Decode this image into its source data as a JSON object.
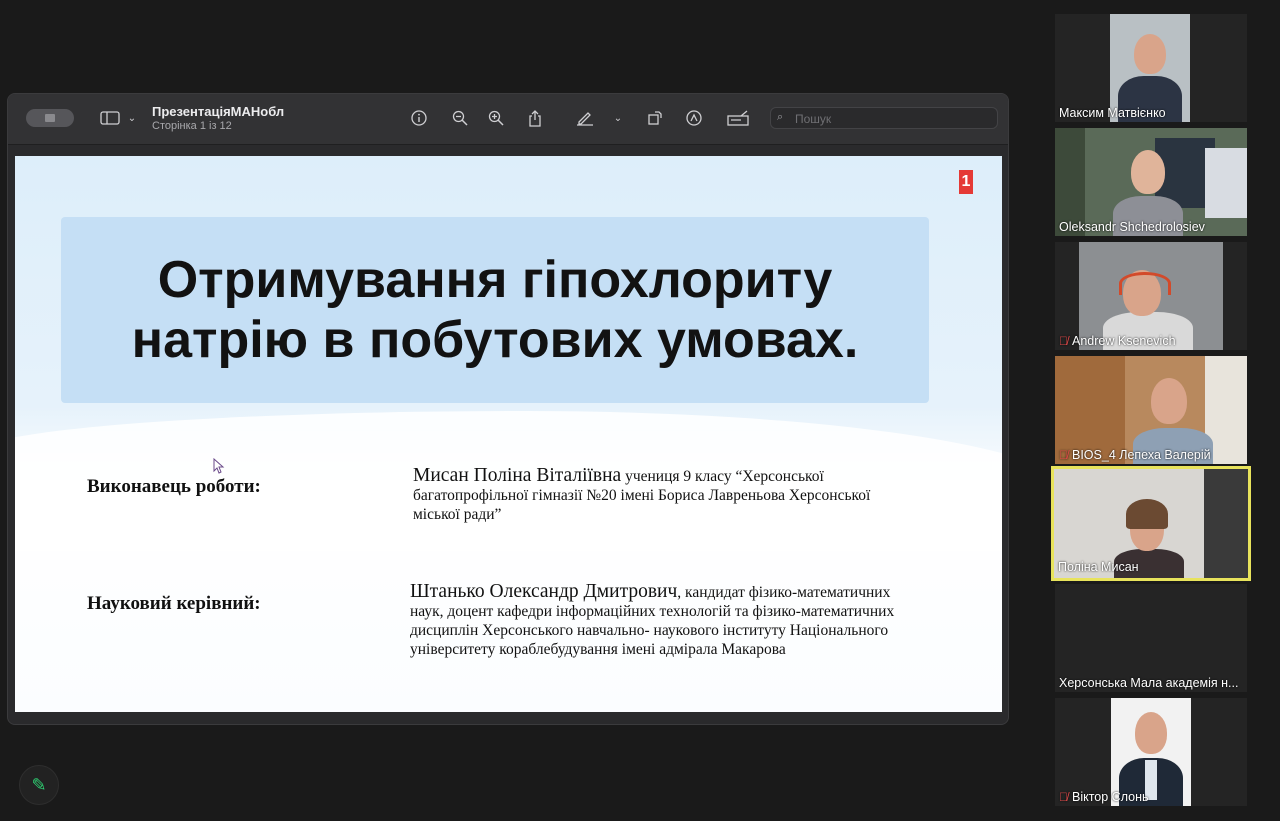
{
  "preview": {
    "doc_title": "ПрезентаціяМАНобл",
    "page_info": "Сторінка 1 із 12",
    "search_placeholder": "Пошук"
  },
  "slide": {
    "number": "1",
    "title_line1": "Отримування гіпохлориту",
    "title_line2": "натрію в побутових умовах.",
    "performer_label": "Виконавець роботи:",
    "performer_name": "Мисан Поліна Віталіївна",
    "performer_line1_rest": " учениця 9 класу “Херсонської",
    "performer_line2": "багатопрофільної гімназії №20 імені Бориса Лавреньова Херсонської",
    "performer_line3": "міської ради”",
    "supervisor_label": "Науковий керівний:",
    "supervisor_name": "Штанько Олександр Дмитрович",
    "supervisor_line1_rest": ", кандидат фізико-математичних",
    "supervisor_line2": "наук, доцент кафедри інформаційних технологій та фізико-математичних",
    "supervisor_line3": "дисциплін Херсонського навчально- наукового інституту Національного",
    "supervisor_line4": "університету кораблебудування імені адмірала Макарова"
  },
  "participants": [
    {
      "name": "Максим Матвієнко",
      "muted": false
    },
    {
      "name": "Oleksandr Shchedrolosiev",
      "muted": false
    },
    {
      "name": "Andrew Ksenevich",
      "muted": true
    },
    {
      "name": "BIOS_4 Лепеха Валерій",
      "muted": true
    },
    {
      "name": "Поліна Мисан",
      "muted": false,
      "active": true
    },
    {
      "name": "Херсонська Мала академія н...",
      "muted": false
    },
    {
      "name": "Віктор Слонь",
      "muted": true
    }
  ],
  "colors": {
    "active_border": "#e8e35c",
    "mute_icon": "#e24a4a",
    "slide_number_bg": "#e53935",
    "title_box_bg": "#c5dff5"
  }
}
